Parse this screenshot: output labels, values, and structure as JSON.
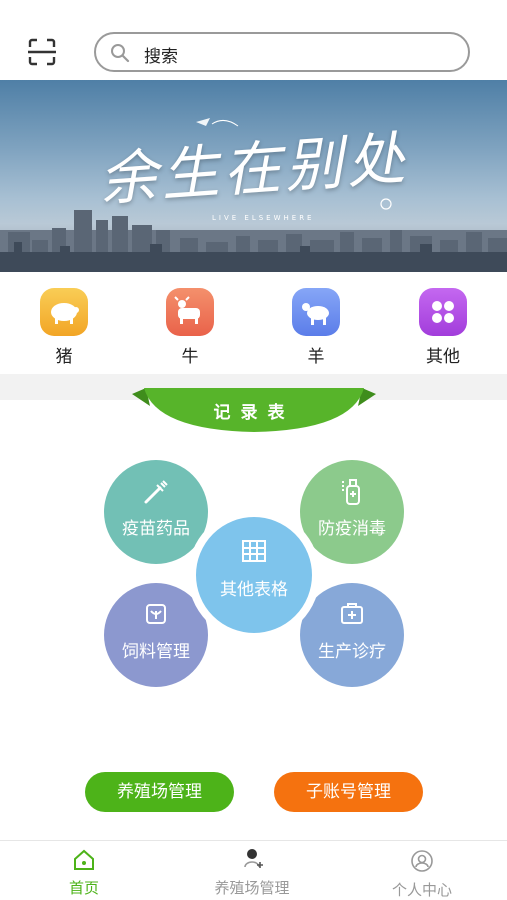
{
  "search": {
    "placeholder": "搜索",
    "icon": "search-icon",
    "scan_icon": "scan-icon"
  },
  "banner": {
    "title": "余生在别处",
    "subtitle": "LIVE ELSEWHERE"
  },
  "categories": [
    {
      "label": "猪",
      "icon": "pig-icon",
      "color": "#f6b53b"
    },
    {
      "label": "牛",
      "icon": "cow-icon",
      "color": "#ef7a5c"
    },
    {
      "label": "羊",
      "icon": "sheep-icon",
      "color": "#6f8ff2"
    },
    {
      "label": "其他",
      "icon": "grid-icon",
      "color": "#b34ee5"
    }
  ],
  "record": {
    "title": "记录表",
    "color": "#57b42a"
  },
  "tiles": [
    {
      "label": "疫苗药品",
      "icon": "syringe-icon",
      "color": "#72c0b5"
    },
    {
      "label": "防疫消毒",
      "icon": "spray-bottle-icon",
      "color": "#8cca8c"
    },
    {
      "label": "饲料管理",
      "icon": "feed-bag-icon",
      "color": "#8c98cf"
    },
    {
      "label": "生产诊疗",
      "icon": "medical-kit-icon",
      "color": "#87a8d8"
    },
    {
      "label": "其他表格",
      "icon": "table-icon",
      "color": "#7ec4ec"
    }
  ],
  "actions": {
    "farm_management": "养殖场管理",
    "subaccount_management": "子账号管理",
    "green": "#4db319",
    "orange": "#f5720f"
  },
  "nav": [
    {
      "label": "首页",
      "icon": "home-icon",
      "active": true
    },
    {
      "label": "养殖场管理",
      "icon": "add-farm-icon",
      "active": false
    },
    {
      "label": "个人中心",
      "icon": "person-icon",
      "active": false
    }
  ],
  "colors": {
    "nav_active": "#4db319",
    "nav_inactive": "#999999"
  }
}
